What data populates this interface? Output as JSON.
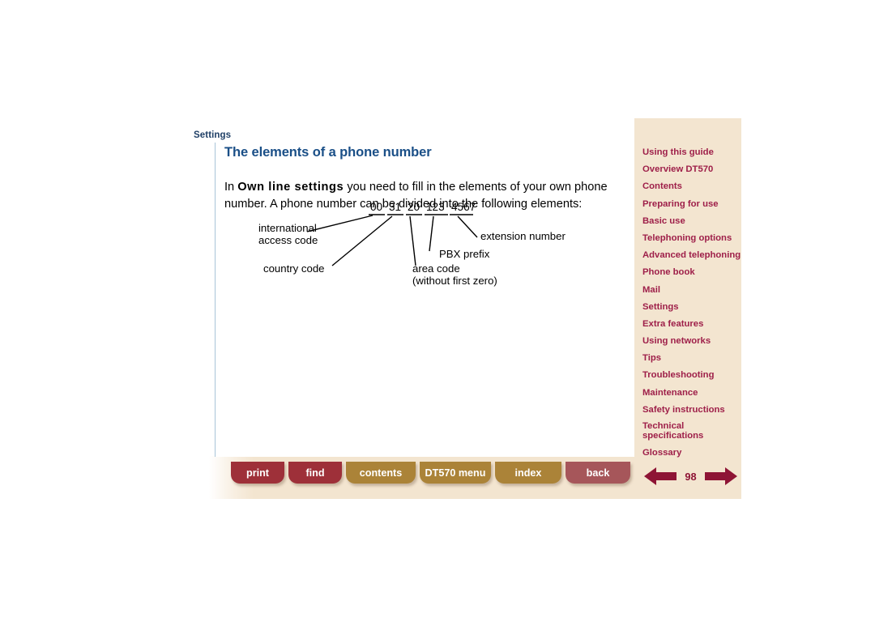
{
  "breadcrumb": "Settings",
  "page_title": "The elements of a phone number",
  "body": {
    "lead_in": "In ",
    "bold_term": "Own line settings",
    "rest": " you need to fill in the elements of your own phone number. A phone number can be divided into the following elements:"
  },
  "diagram": {
    "number_segments": [
      "00",
      "31",
      "20",
      "123",
      "4567"
    ],
    "number_full": "00 31 20 123 4567",
    "labels": {
      "international_access_code_line1": "international",
      "international_access_code_line2": "access code",
      "country_code": "country code",
      "area_code_line1": "area code",
      "area_code_line2": "(without first zero)",
      "pbx_prefix": "PBX prefix",
      "extension_number": "extension number"
    }
  },
  "sidebar": {
    "items": [
      {
        "label": "Using this guide",
        "two_line": false
      },
      {
        "label": "Overview DT570",
        "two_line": false
      },
      {
        "label": "Contents",
        "two_line": false
      },
      {
        "label": "Preparing for use",
        "two_line": false
      },
      {
        "label": "Basic use",
        "two_line": false
      },
      {
        "label": "Telephoning options",
        "two_line": false
      },
      {
        "label": "Advanced telephoning",
        "two_line": false
      },
      {
        "label": "Phone book",
        "two_line": false
      },
      {
        "label": "Mail",
        "two_line": false
      },
      {
        "label": "Settings",
        "two_line": false
      },
      {
        "label": "Extra features",
        "two_line": false
      },
      {
        "label": "Using networks",
        "two_line": false
      },
      {
        "label": "Tips",
        "two_line": false
      },
      {
        "label": "Troubleshooting",
        "two_line": false
      },
      {
        "label": "Maintenance",
        "two_line": false
      },
      {
        "label": "Safety instructions",
        "two_line": false
      },
      {
        "label": "Technical specifications",
        "two_line": true
      },
      {
        "label": "Glossary",
        "two_line": false
      }
    ]
  },
  "footer": {
    "buttons": [
      {
        "label": "print",
        "style": "red"
      },
      {
        "label": "find",
        "style": "red"
      },
      {
        "label": "contents",
        "style": "gold"
      },
      {
        "label": "DT570 menu",
        "style": "gold"
      },
      {
        "label": "index",
        "style": "gold"
      },
      {
        "label": "back",
        "style": "back"
      }
    ],
    "page_number": "98",
    "prev_icon": "arrow-left-icon",
    "next_icon": "arrow-right-icon"
  },
  "colors": {
    "sidebar_bg": "#f3e5d0",
    "nav_link": "#9e1f49",
    "title": "#1a4f87",
    "breadcrumb": "#1f3f66",
    "button_red": "#9e3039",
    "button_gold": "#ab8338",
    "button_back": "#a6565a",
    "arrow": "#8e1435",
    "panel_border": "#a8c4d8"
  }
}
